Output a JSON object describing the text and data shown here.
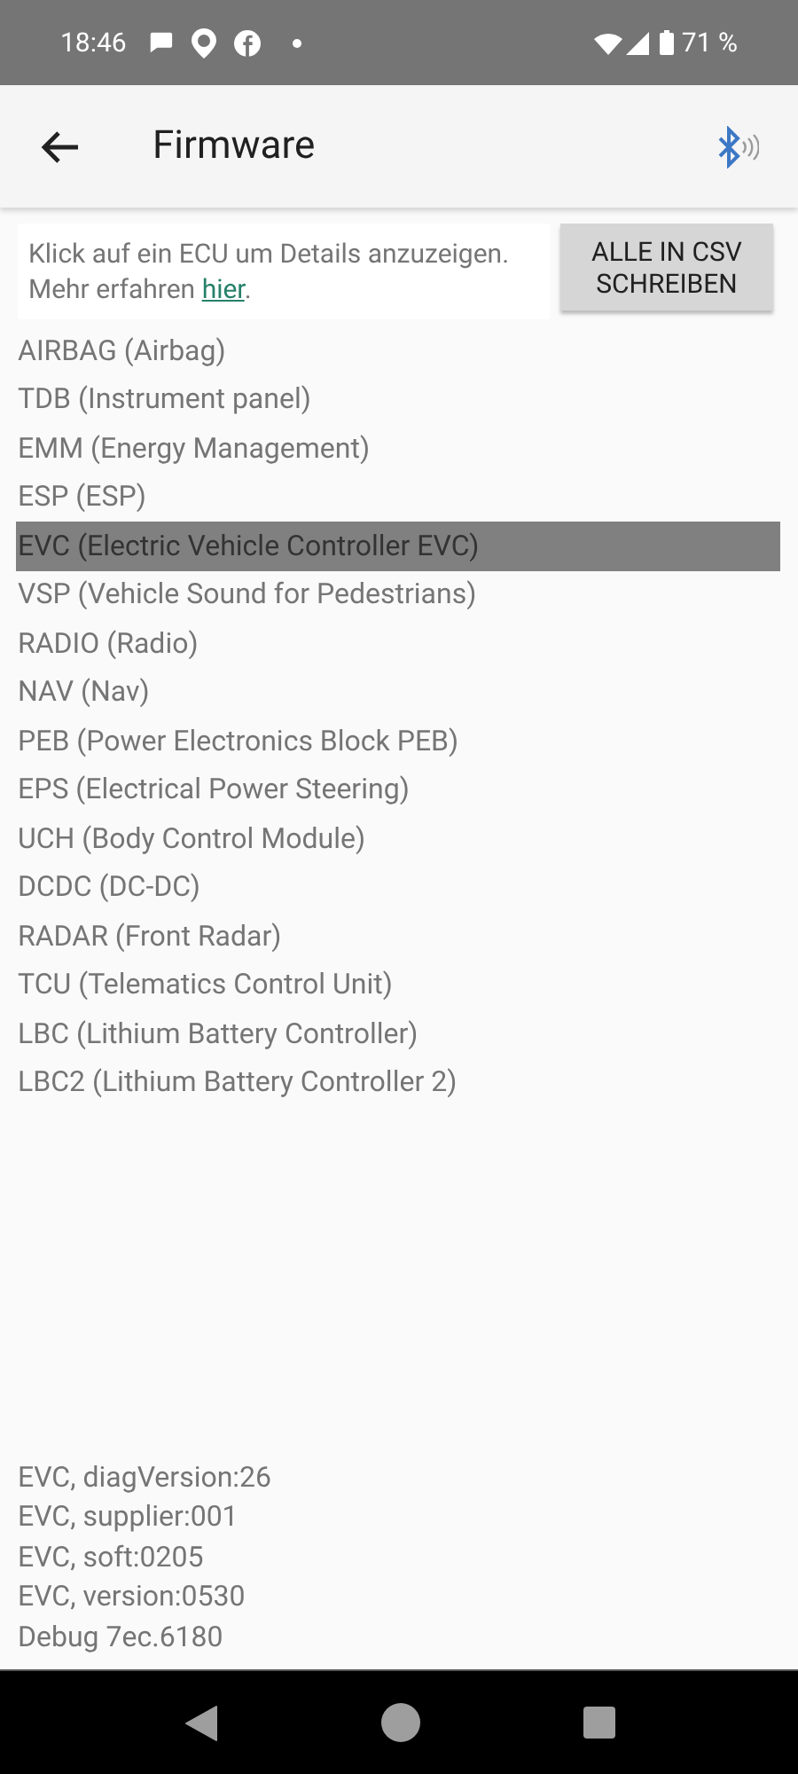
{
  "status_bar": {
    "time": "18:46",
    "battery": "71 %"
  },
  "app_bar": {
    "title": "Firmware"
  },
  "info": {
    "text": "Klick auf ein ECU um Details anzuzeigen. Mehr erfahren ",
    "link": "hier",
    "suffix": "."
  },
  "export_button": "ALLE IN CSV SCHREIBEN",
  "ecus": [
    {
      "label": "AIRBAG (Airbag)",
      "selected": false
    },
    {
      "label": "TDB (Instrument panel)",
      "selected": false
    },
    {
      "label": "EMM (Energy Management)",
      "selected": false
    },
    {
      "label": "ESP (ESP)",
      "selected": false
    },
    {
      "label": "EVC (Electric Vehicle Controller EVC)",
      "selected": true
    },
    {
      "label": "VSP (Vehicle Sound for Pedestrians)",
      "selected": false
    },
    {
      "label": "RADIO (Radio)",
      "selected": false
    },
    {
      "label": "NAV (Nav)",
      "selected": false
    },
    {
      "label": "PEB (Power Electronics Block PEB)",
      "selected": false
    },
    {
      "label": "EPS (Electrical Power Steering)",
      "selected": false
    },
    {
      "label": "UCH (Body Control Module)",
      "selected": false
    },
    {
      "label": "DCDC (DC-DC)",
      "selected": false
    },
    {
      "label": "RADAR (Front Radar)",
      "selected": false
    },
    {
      "label": "TCU (Telematics Control Unit)",
      "selected": false
    },
    {
      "label": "LBC (Lithium Battery Controller)",
      "selected": false
    },
    {
      "label": "LBC2 (Lithium Battery Controller 2)",
      "selected": false
    }
  ],
  "details": [
    "EVC, diagVersion:26",
    "EVC, supplier:001",
    "EVC, soft:0205",
    "EVC, version:0530",
    "Debug 7ec.6180"
  ]
}
